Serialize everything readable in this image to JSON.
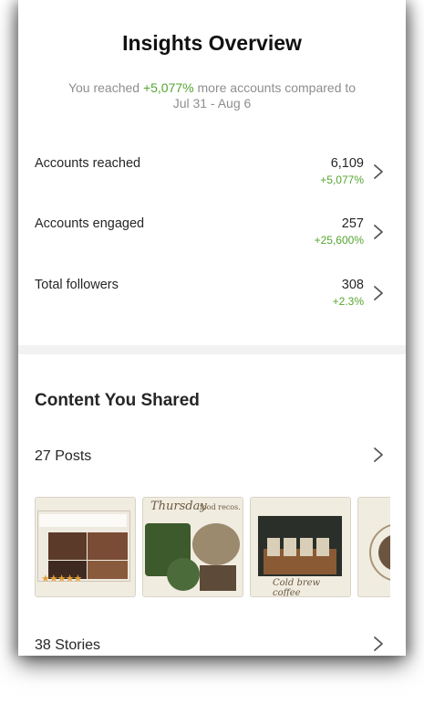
{
  "header": {
    "title": "Insights Overview",
    "subtitle_pre": "You reached ",
    "subtitle_highlight": "+5,077%",
    "subtitle_post": " more accounts compared to",
    "date_range": "Jul 31 - Aug 6"
  },
  "metrics": [
    {
      "label": "Accounts reached",
      "value": "6,109",
      "delta": "+5,077%"
    },
    {
      "label": "Accounts engaged",
      "value": "257",
      "delta": "+25,600%"
    },
    {
      "label": "Total followers",
      "value": "308",
      "delta": "+2.3%"
    }
  ],
  "content": {
    "title": "Content You Shared",
    "posts_label": "27 Posts",
    "stories_label": "38 Stories",
    "thumb_texts": {
      "thursday": "Thursday",
      "food_recos": "food recos.",
      "cold_brew": "Cold brew coffee"
    }
  },
  "colors": {
    "accent_green": "#55a630",
    "text": "#262626",
    "muted": "#8e8e8e"
  },
  "icons": [
    "chevron-right-icon"
  ]
}
